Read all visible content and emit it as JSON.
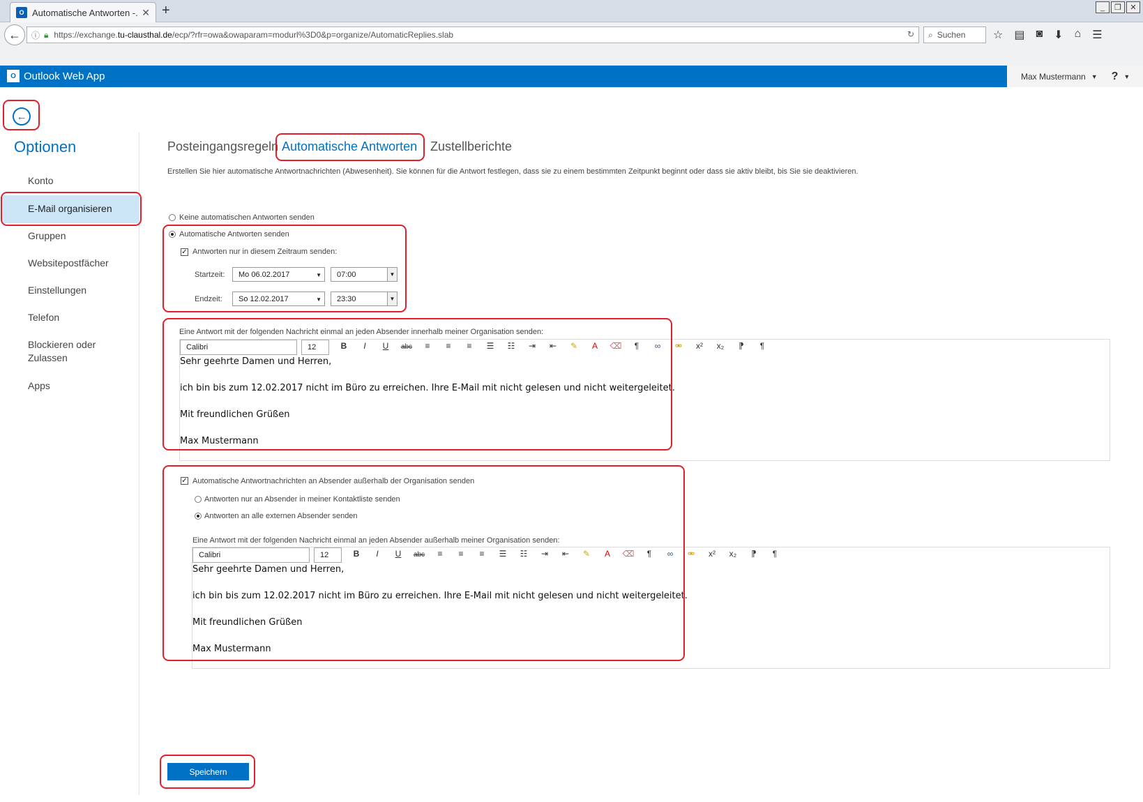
{
  "browser": {
    "tab_title": "Automatische Antworten -...",
    "url_prefix": "https://exchange.",
    "url_host": "tu-clausthal.de",
    "url_path": "/ecp/?rfr=owa&owaparam=modurl%3D0&p=organize/AutomaticReplies.slab",
    "search_placeholder": "Suchen"
  },
  "header": {
    "app_name": "Outlook Web App",
    "user_name": "Max Mustermann",
    "help": "?"
  },
  "sidebar": {
    "title": "Optionen",
    "items": [
      {
        "label": "Konto"
      },
      {
        "label": "E-Mail organisieren",
        "selected": true
      },
      {
        "label": "Gruppen"
      },
      {
        "label": "Websitepostfächer"
      },
      {
        "label": "Einstellungen"
      },
      {
        "label": "Telefon"
      },
      {
        "label": "Blockieren oder"
      },
      {
        "label": "Zulassen"
      },
      {
        "label": "Apps"
      }
    ]
  },
  "tabs": [
    {
      "label": "Posteingangsregeln"
    },
    {
      "label": "Automatische Antworten",
      "active": true
    },
    {
      "label": "Zustellberichte"
    }
  ],
  "description": "Erstellen Sie hier automatische Antwortnachrichten (Abwesenheit). Sie können für die Antwort festlegen, dass sie zu einem bestimmten Zeitpunkt beginnt oder dass sie aktiv bleibt, bis Sie sie deaktivieren.",
  "form": {
    "radio_none": "Keine automatischen Antworten senden",
    "radio_send": "Automatische Antworten senden",
    "chk_timerange": "Antworten nur in diesem Zeitraum senden:",
    "start_label": "Startzeit:",
    "start_date": "Mo 06.02.2017",
    "start_time": "07:00",
    "end_label": "Endzeit:",
    "end_date": "So 12.02.2017",
    "end_time": "23:30",
    "internal_label": "Eine Antwort mit der folgenden Nachricht einmal an jeden Absender innerhalb meiner Organisation senden:",
    "chk_external": "Automatische Antwortnachrichten an Absender außerhalb der Organisation senden",
    "radio_contacts": "Antworten nur an Absender in meiner Kontaktliste senden",
    "radio_all_external": "Antworten an alle externen Absender senden",
    "external_label": "Eine Antwort mit der folgenden Nachricht einmal an jeden Absender außerhalb meiner Organisation senden:",
    "font_name": "Calibri",
    "font_size": "12",
    "message_lines": [
      "Sehr geehrte Damen und Herren,",
      "ich bin bis zum 12.02.2017 nicht im Büro zu erreichen. Ihre E-Mail mit nicht gelesen und nicht weitergeleitet.",
      "Mit freundlichen Grüßen",
      "Max Mustermann"
    ],
    "save_label": "Speichern"
  },
  "colors": {
    "brand": "#0072c6",
    "annotation": "#e0202b",
    "selected_nav": "#cde6f7"
  }
}
